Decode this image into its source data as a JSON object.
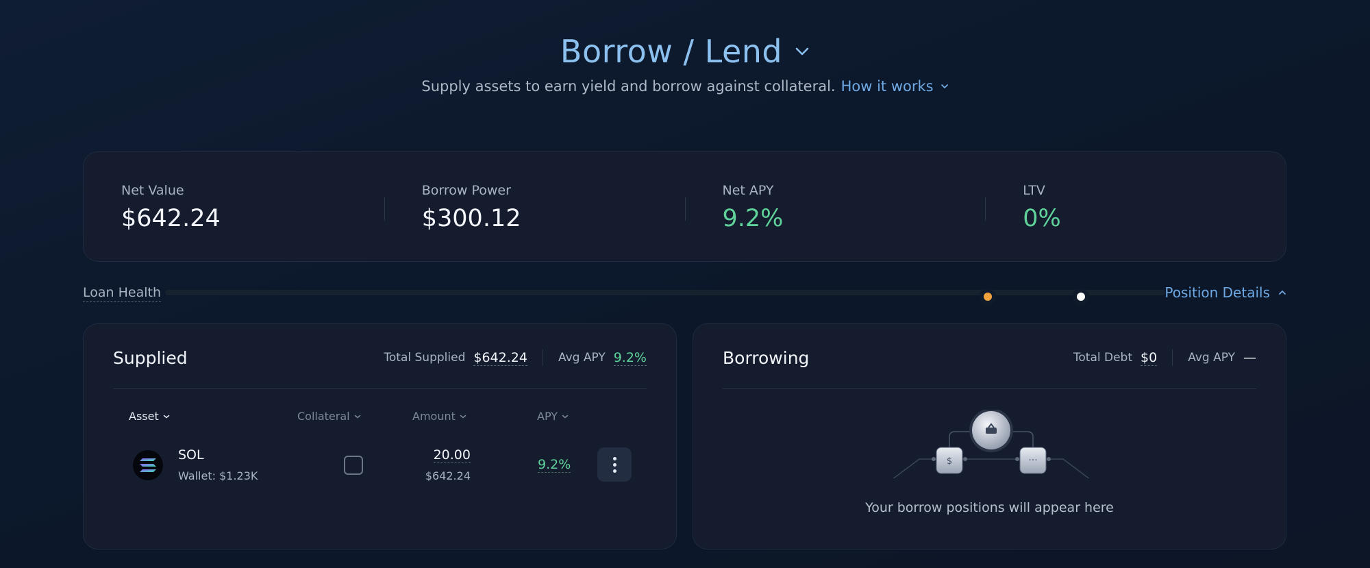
{
  "header": {
    "title": "Borrow / Lend",
    "subtitle": "Supply assets to earn yield and borrow against collateral.",
    "how_it_works": "How it works"
  },
  "stats": [
    {
      "label": "Net Value",
      "value": "$642.24"
    },
    {
      "label": "Borrow Power",
      "value": "$300.12"
    },
    {
      "label": "Net APY",
      "value": "9.2%"
    },
    {
      "label": "LTV",
      "value": "0%"
    }
  ],
  "health": {
    "label": "Loan Health",
    "position_details": "Position Details"
  },
  "supplied": {
    "title": "Supplied",
    "total_label": "Total Supplied",
    "total_value": "$642.24",
    "avg_apy_label": "Avg APY",
    "avg_apy_value": "9.2%",
    "columns": [
      "Asset",
      "Collateral",
      "Amount",
      "APY"
    ],
    "rows": [
      {
        "asset": "SOL",
        "wallet": "Wallet: $1.23K",
        "amount": "20.00",
        "amount_usd": "$642.24",
        "apy": "9.2%"
      }
    ]
  },
  "borrowing": {
    "title": "Borrowing",
    "total_label": "Total Debt",
    "total_value": "$0",
    "avg_apy_label": "Avg APY",
    "avg_apy_value": "—",
    "empty_text": "Your borrow positions will appear here"
  },
  "colors": {
    "accent_blue": "#6fa9e3",
    "positive_green": "#5fd39a",
    "health_marker": "#f0a23f"
  }
}
